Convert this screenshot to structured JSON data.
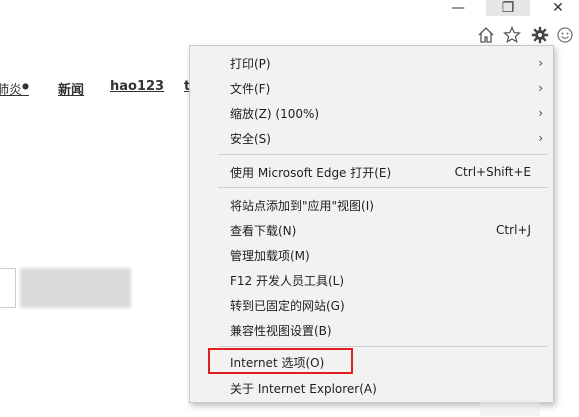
{
  "window_controls": {
    "minimize": "—",
    "restore": "❐",
    "close": "✕"
  },
  "toolbar_icons": [
    "home-icon",
    "star-icon",
    "gear-icon",
    "smiley-icon"
  ],
  "page_links": {
    "partial_left": "肺炎",
    "news": "新闻",
    "hao123": "hao123",
    "partial_right": "t"
  },
  "menu": {
    "items": [
      {
        "label": "打印(P)",
        "submenu": true
      },
      {
        "label": "文件(F)",
        "submenu": true
      },
      {
        "label": "缩放(Z) (100%)",
        "submenu": true
      },
      {
        "label": "安全(S)",
        "submenu": true
      },
      {
        "label": "使用 Microsoft Edge 打开(E)",
        "shortcut": "Ctrl+Shift+E"
      },
      {
        "label": "将站点添加到\"应用\"视图(I)"
      },
      {
        "label": "查看下载(N)",
        "shortcut": "Ctrl+J"
      },
      {
        "label": "管理加载项(M)"
      },
      {
        "label": "F12 开发人员工具(L)"
      },
      {
        "label": "转到已固定的网站(G)"
      },
      {
        "label": "兼容性视图设置(B)"
      },
      {
        "label": "Internet 选项(O)"
      },
      {
        "label": "关于 Internet Explorer(A)"
      }
    ],
    "arrow": "›",
    "highlight_color": "#e02020"
  }
}
